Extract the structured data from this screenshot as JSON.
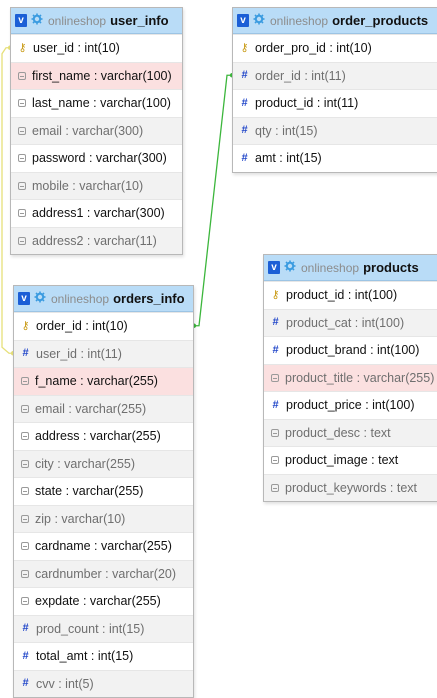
{
  "tables": [
    {
      "id": "user_info",
      "db": "onlineshop",
      "name": "user_info",
      "columns": [
        {
          "label": "user_id : int(10)",
          "icon": "primary-key-icon",
          "style": "normal"
        },
        {
          "label": "first_name : varchar(100)",
          "icon": "text-field-icon",
          "style": "highlight"
        },
        {
          "label": "last_name : varchar(100)",
          "icon": "text-field-icon",
          "style": "normal"
        },
        {
          "label": "email : varchar(300)",
          "icon": "text-field-icon",
          "style": "gray"
        },
        {
          "label": "password : varchar(300)",
          "icon": "text-field-icon",
          "style": "normal"
        },
        {
          "label": "mobile : varchar(10)",
          "icon": "text-field-icon",
          "style": "gray"
        },
        {
          "label": "address1 : varchar(300)",
          "icon": "text-field-icon",
          "style": "normal"
        },
        {
          "label": "address2 : varchar(11)",
          "icon": "text-field-icon",
          "style": "gray"
        }
      ]
    },
    {
      "id": "order_products",
      "db": "onlineshop",
      "name": "order_products",
      "columns": [
        {
          "label": "order_pro_id : int(10)",
          "icon": "primary-key-icon",
          "style": "normal"
        },
        {
          "label": "order_id : int(11)",
          "icon": "numeric-field-icon",
          "style": "gray"
        },
        {
          "label": "product_id : int(11)",
          "icon": "numeric-field-icon",
          "style": "normal"
        },
        {
          "label": "qty : int(15)",
          "icon": "numeric-field-icon",
          "style": "gray"
        },
        {
          "label": "amt : int(15)",
          "icon": "numeric-field-icon",
          "style": "normal"
        }
      ]
    },
    {
      "id": "products",
      "db": "onlineshop",
      "name": "products",
      "columns": [
        {
          "label": "product_id : int(100)",
          "icon": "primary-key-icon",
          "style": "normal"
        },
        {
          "label": "product_cat : int(100)",
          "icon": "numeric-field-icon",
          "style": "gray"
        },
        {
          "label": "product_brand : int(100)",
          "icon": "numeric-field-icon",
          "style": "normal"
        },
        {
          "label": "product_title : varchar(255)",
          "icon": "text-field-icon",
          "style": "highlight-gray"
        },
        {
          "label": "product_price : int(100)",
          "icon": "numeric-field-icon",
          "style": "normal"
        },
        {
          "label": "product_desc : text",
          "icon": "text-field-icon",
          "style": "gray"
        },
        {
          "label": "product_image : text",
          "icon": "text-field-icon",
          "style": "normal"
        },
        {
          "label": "product_keywords : text",
          "icon": "text-field-icon",
          "style": "gray"
        }
      ]
    },
    {
      "id": "orders_info",
      "db": "onlineshop",
      "name": "orders_info",
      "columns": [
        {
          "label": "order_id : int(10)",
          "icon": "primary-key-icon",
          "style": "normal"
        },
        {
          "label": "user_id : int(11)",
          "icon": "numeric-field-icon",
          "style": "gray"
        },
        {
          "label": "f_name : varchar(255)",
          "icon": "text-field-icon",
          "style": "highlight"
        },
        {
          "label": "email : varchar(255)",
          "icon": "text-field-icon",
          "style": "gray"
        },
        {
          "label": "address : varchar(255)",
          "icon": "text-field-icon",
          "style": "normal"
        },
        {
          "label": "city : varchar(255)",
          "icon": "text-field-icon",
          "style": "gray"
        },
        {
          "label": "state : varchar(255)",
          "icon": "text-field-icon",
          "style": "normal"
        },
        {
          "label": "zip : varchar(10)",
          "icon": "text-field-icon",
          "style": "gray"
        },
        {
          "label": "cardname : varchar(255)",
          "icon": "text-field-icon",
          "style": "normal"
        },
        {
          "label": "cardnumber : varchar(20)",
          "icon": "text-field-icon",
          "style": "gray"
        },
        {
          "label": "expdate : varchar(255)",
          "icon": "text-field-icon",
          "style": "normal"
        },
        {
          "label": "prod_count : int(15)",
          "icon": "numeric-field-icon",
          "style": "gray"
        },
        {
          "label": "total_amt : int(15)",
          "icon": "numeric-field-icon",
          "style": "normal"
        },
        {
          "label": "cvv : int(5)",
          "icon": "numeric-field-icon",
          "style": "gray"
        }
      ]
    }
  ],
  "relations": [
    {
      "from": "orders_info.user_id",
      "to": "user_info.user_id",
      "color": "#e6e07a"
    },
    {
      "from": "orders_info.order_id",
      "to": "order_products.order_id",
      "color": "#3cb63c"
    }
  ],
  "colors": {
    "header_bg": "#b9dcf7",
    "badge": "#1c5fd6",
    "gear": "#3a9be0",
    "key": "#c99b16",
    "numeric": "#2247c9",
    "highlight_row": "#fbe0e0"
  }
}
